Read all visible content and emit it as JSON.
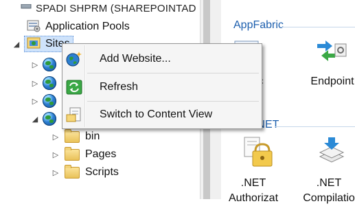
{
  "tree": {
    "server_label": "SPADI SHPRM (SHAREPOINTAD",
    "application_pools": "Application Pools",
    "sites": "Sites",
    "children": [
      {
        "label": "bin"
      },
      {
        "label": "Pages"
      },
      {
        "label": "Scripts"
      }
    ]
  },
  "context_menu": {
    "items": [
      {
        "label": "Add Website...",
        "icon": "add-website-icon"
      },
      {
        "label": "Refresh",
        "icon": "refresh-icon"
      },
      {
        "label": "Switch to Content View",
        "icon": "content-view-icon"
      }
    ]
  },
  "content": {
    "section_appfabric": "AppFabric",
    "appfabric_items": [
      {
        "label_line1": "abric",
        "label_line2": "oard"
      },
      {
        "label_line1": "Endpoint",
        "label_line2": ""
      }
    ],
    "section_aspnet": "ASP.NET",
    "aspnet_items": [
      {
        "label_line1": ".NET",
        "label_line2": "Authorizat"
      },
      {
        "label_line1": ".NET",
        "label_line2": "Compilatio"
      }
    ]
  }
}
